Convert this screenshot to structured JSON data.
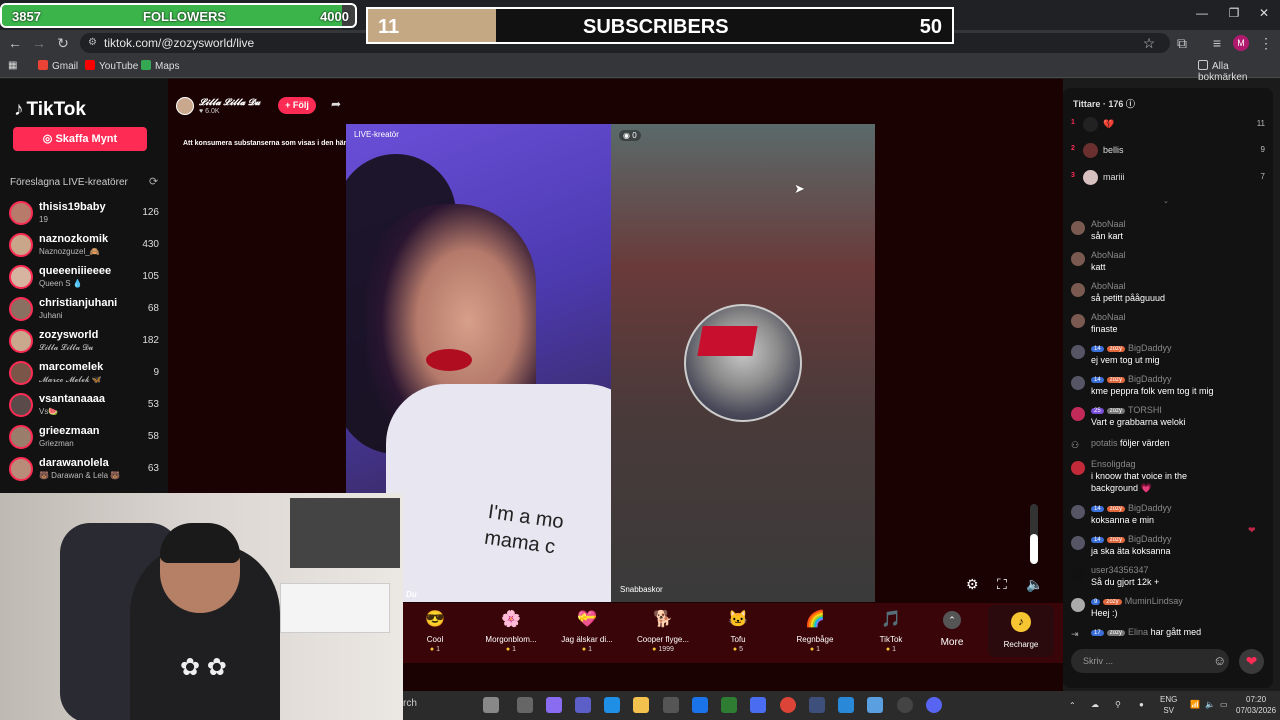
{
  "overlays": {
    "followers": {
      "current": "3857",
      "label": "FOLLOWERS",
      "goal": "4000",
      "progress_fraction": 0.964
    },
    "subscribers": {
      "current": "11",
      "label": "SUBSCRIBERS",
      "goal": "50",
      "progress_fraction": 0.22
    }
  },
  "browser": {
    "url": "tiktok.com/@zozysworld/live",
    "bookmarks": [
      "Gmail",
      "YouTube",
      "Maps"
    ],
    "all_bookmarks": "Alla bokmärken",
    "profile_initial": "M"
  },
  "sidebar": {
    "logo": "TikTok",
    "coin_button": "Skaffa Mynt",
    "section_title": "Föreslagna LIVE-kreatörer",
    "creators": [
      {
        "name": "thisis19baby",
        "sub": "19",
        "count": "126"
      },
      {
        "name": "naznozkomik",
        "sub": "Naznozguzel_🙈",
        "count": "430"
      },
      {
        "name": "queeeniiieeee",
        "sub": "Queen S 💧",
        "count": "105"
      },
      {
        "name": "christianjuhani",
        "sub": "Juhani",
        "count": "68"
      },
      {
        "name": "zozysworld",
        "sub": "𝓛𝓲𝓵𝓵𝓪 𝓛𝓲𝓵𝓵𝓪 𝓓𝓾",
        "count": "182"
      },
      {
        "name": "marcomelek",
        "sub": "𝓜𝓪𝓻𝓬𝓸 𝓜𝓮𝓵𝓮𝓴 🦋",
        "count": "9"
      },
      {
        "name": "vsantanaaaa",
        "sub": "Vs🍉",
        "count": "53"
      },
      {
        "name": "grieezmaan",
        "sub": "Griezman",
        "count": "58"
      },
      {
        "name": "darawanolela",
        "sub": "🐻 Darawan & Lela 🐻",
        "count": "63"
      }
    ]
  },
  "live": {
    "host_name": "𝓛𝓲𝓵𝓵𝓪 𝓛𝓲𝓵𝓵𝓪 𝓓𝓾",
    "host_likes": "6.0K",
    "follow_label": "+ Följ",
    "warning": "Att konsumera substanserna som visas i den här LIVE...",
    "left_label": "LIVE-kreatör",
    "right_count": "0",
    "right_name": "Snabbaskor",
    "left_name_partial": "Du",
    "shirt_text": "I'm a mo\nmama c",
    "volume_fraction": 0.5
  },
  "gifts": [
    {
      "name": "Cool",
      "price": "1",
      "icon": "😎"
    },
    {
      "name": "Morgonblom...",
      "price": "1",
      "icon": "🌸"
    },
    {
      "name": "Jag älskar di...",
      "price": "1",
      "icon": "💝"
    },
    {
      "name": "Cooper flyge...",
      "price": "1999",
      "icon": "🐕"
    },
    {
      "name": "Tofu",
      "price": "5",
      "icon": "🐱"
    },
    {
      "name": "Regnbåge",
      "price": "1",
      "icon": "🌈"
    },
    {
      "name": "TikTok",
      "price": "1",
      "icon": "🎵"
    }
  ],
  "gift_more": "More",
  "recharge": "Recharge",
  "chat": {
    "viewers_title": "Tittare · 176",
    "viewers": [
      {
        "rank": "1",
        "name": "💔",
        "count": "11"
      },
      {
        "rank": "2",
        "name": "bellis",
        "count": "9"
      },
      {
        "rank": "3",
        "name": "mariii",
        "count": "7"
      }
    ],
    "messages": [
      {
        "user": "AboNaal",
        "text": "sån kart"
      },
      {
        "user": "AboNaal",
        "text": "katt"
      },
      {
        "user": "AboNaal",
        "text": "så petitt pååguuud"
      },
      {
        "user": "AboNaal",
        "text": "finaste"
      },
      {
        "user": "BigDaddyy",
        "level": "14",
        "fan": "zozy",
        "text": "ej vem tog ut mig"
      },
      {
        "user": "BigDaddyy",
        "level": "14",
        "fan": "zozy",
        "text": "kme peppra folk vem tog it mig"
      },
      {
        "user": "TORSHI",
        "level": "25",
        "fan": "zozy",
        "text": "Vart e grabbarna weloki"
      },
      {
        "user": "potatis",
        "text": "följer värden"
      },
      {
        "user": "Ensoligdag",
        "text": "i knoow that voice in the",
        "text2": "background 💗"
      },
      {
        "user": "BigDaddyy",
        "level": "14",
        "fan": "zozy",
        "text": "koksanna e min"
      },
      {
        "user": "BigDaddyy",
        "level": "14",
        "fan": "zozy",
        "text": "ja ska äta koksanna"
      },
      {
        "user": "user34356347",
        "text": "Så du gjort 12k +"
      },
      {
        "user": "MuminLindsay",
        "level": "9",
        "fan": "zozy",
        "text": "Heej :)"
      },
      {
        "user": "Elina",
        "level": "17",
        "fan": "zozy",
        "text": "har gått med"
      }
    ],
    "input_placeholder": "Skriv ..."
  },
  "taskbar": {
    "search_partial": "rch",
    "lang": "ENG",
    "lang_sub": "SV",
    "time": "07:20",
    "date": "07/03/2026"
  },
  "colors": {
    "accent": "#fe2c55",
    "followers_fill": "#3bb44a",
    "subs_fill": "#c4a783"
  }
}
